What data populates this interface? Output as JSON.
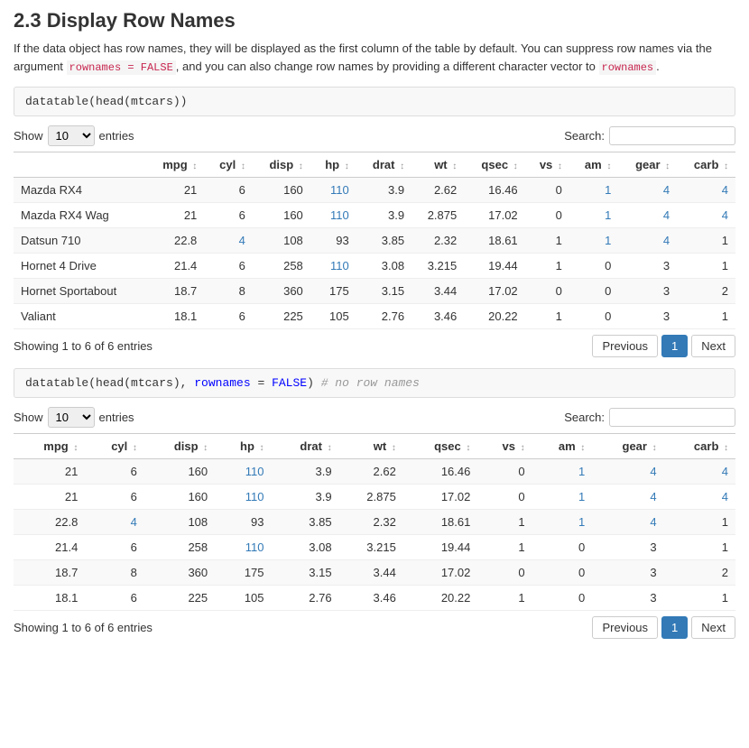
{
  "page": {
    "title": "2.3 Display Row Names",
    "description": "If the data object has row names, they will be displayed as the first column of the table by default. You can suppress row names via the argument ",
    "description2": ", and you can also change row names by providing a different character vector to ",
    "arg_rownames": "rownames = FALSE",
    "arg_rownames_plain": "rownames",
    "period": "."
  },
  "table1": {
    "code": "datatable(head(mtcars))",
    "show_label": "Show",
    "show_value": "10",
    "entries_label": "entries",
    "search_label": "Search:",
    "search_value": "",
    "columns": [
      "",
      "mpg",
      "cyl",
      "disp",
      "hp",
      "drat",
      "wt",
      "qsec",
      "vs",
      "am",
      "gear",
      "carb"
    ],
    "rows": [
      {
        "name": "Mazda RX4",
        "mpg": "21",
        "cyl": "6",
        "disp": "160",
        "hp": "110",
        "drat": "3.9",
        "wt": "2.62",
        "qsec": "16.46",
        "vs": "0",
        "am": "1",
        "gear": "4",
        "carb": "4"
      },
      {
        "name": "Mazda RX4 Wag",
        "mpg": "21",
        "cyl": "6",
        "disp": "160",
        "hp": "110",
        "drat": "3.9",
        "wt": "2.875",
        "qsec": "17.02",
        "vs": "0",
        "am": "1",
        "gear": "4",
        "carb": "4"
      },
      {
        "name": "Datsun 710",
        "mpg": "22.8",
        "cyl": "4",
        "disp": "108",
        "hp": "93",
        "drat": "3.85",
        "wt": "2.32",
        "qsec": "18.61",
        "vs": "1",
        "am": "1",
        "gear": "4",
        "carb": "1"
      },
      {
        "name": "Hornet 4 Drive",
        "mpg": "21.4",
        "cyl": "6",
        "disp": "258",
        "hp": "110",
        "drat": "3.08",
        "wt": "3.215",
        "qsec": "19.44",
        "vs": "1",
        "am": "0",
        "gear": "3",
        "carb": "1"
      },
      {
        "name": "Hornet Sportabout",
        "mpg": "18.7",
        "cyl": "8",
        "disp": "360",
        "hp": "175",
        "drat": "3.15",
        "wt": "3.44",
        "qsec": "17.02",
        "vs": "0",
        "am": "0",
        "gear": "3",
        "carb": "2"
      },
      {
        "name": "Valiant",
        "mpg": "18.1",
        "cyl": "6",
        "disp": "225",
        "hp": "105",
        "drat": "2.76",
        "wt": "3.46",
        "qsec": "20.22",
        "vs": "1",
        "am": "0",
        "gear": "3",
        "carb": "1"
      }
    ],
    "showing_text": "Showing 1 to 6 of 6 entries",
    "prev_label": "Previous",
    "next_label": "Next",
    "page_num": "1",
    "blue_cols": [
      "cyl",
      "hp",
      "am",
      "gear"
    ],
    "blue_values_by_row": [
      {
        "cyl": false,
        "hp": true,
        "am": true,
        "gear": true,
        "carb": true
      },
      {
        "cyl": false,
        "hp": true,
        "am": true,
        "gear": true,
        "carb": true
      },
      {
        "cyl": true,
        "hp": false,
        "am": true,
        "gear": true,
        "carb": false
      },
      {
        "cyl": false,
        "hp": true,
        "am": false,
        "gear": false,
        "carb": false
      },
      {
        "cyl": false,
        "hp": false,
        "am": false,
        "gear": false,
        "carb": false
      },
      {
        "cyl": false,
        "hp": false,
        "am": false,
        "gear": false,
        "carb": false
      }
    ]
  },
  "table2": {
    "code": "datatable(head(mtcars), rownames = FALSE)",
    "code_comment": "  # no row names",
    "show_label": "Show",
    "show_value": "10",
    "entries_label": "entries",
    "search_label": "Search:",
    "search_value": "",
    "columns": [
      "mpg",
      "cyl",
      "disp",
      "hp",
      "drat",
      "wt",
      "qsec",
      "vs",
      "am",
      "gear",
      "carb"
    ],
    "rows": [
      {
        "mpg": "21",
        "cyl": "6",
        "disp": "160",
        "hp": "110",
        "drat": "3.9",
        "wt": "2.62",
        "qsec": "16.46",
        "vs": "0",
        "am": "1",
        "gear": "4",
        "carb": "4"
      },
      {
        "mpg": "21",
        "cyl": "6",
        "disp": "160",
        "hp": "110",
        "drat": "3.9",
        "wt": "2.875",
        "qsec": "17.02",
        "vs": "0",
        "am": "1",
        "gear": "4",
        "carb": "4"
      },
      {
        "mpg": "22.8",
        "cyl": "4",
        "disp": "108",
        "hp": "93",
        "drat": "3.85",
        "wt": "2.32",
        "qsec": "18.61",
        "vs": "1",
        "am": "1",
        "gear": "4",
        "carb": "1"
      },
      {
        "mpg": "21.4",
        "cyl": "6",
        "disp": "258",
        "hp": "110",
        "drat": "3.08",
        "wt": "3.215",
        "qsec": "19.44",
        "vs": "1",
        "am": "0",
        "gear": "3",
        "carb": "1"
      },
      {
        "mpg": "18.7",
        "cyl": "8",
        "disp": "360",
        "hp": "175",
        "drat": "3.15",
        "wt": "3.44",
        "qsec": "17.02",
        "vs": "0",
        "am": "0",
        "gear": "3",
        "carb": "2"
      },
      {
        "mpg": "18.1",
        "cyl": "6",
        "disp": "225",
        "hp": "105",
        "drat": "2.76",
        "wt": "3.46",
        "qsec": "20.22",
        "vs": "1",
        "am": "0",
        "gear": "3",
        "carb": "1"
      }
    ],
    "showing_text": "Showing 1 to 6 of 6 entries",
    "prev_label": "Previous",
    "next_label": "Next",
    "page_num": "1"
  }
}
